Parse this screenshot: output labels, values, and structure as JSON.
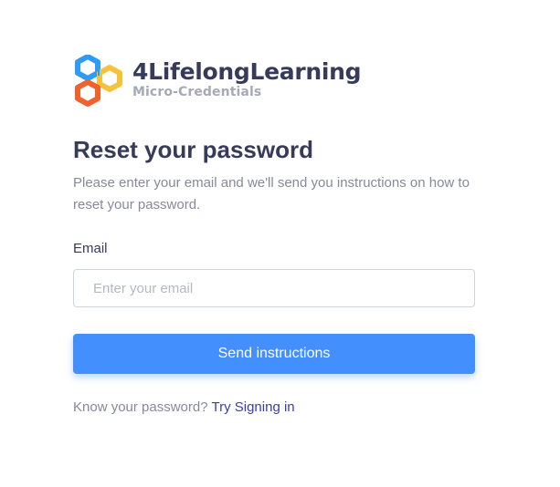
{
  "brand": {
    "name": "4LifelongLearning",
    "tagline": "Micro-Credentials",
    "logo_colors": {
      "blue": "#2e9bf5",
      "yellow": "#f7c23b",
      "orange": "#f0612d"
    },
    "icon": "hexagon-links-logo"
  },
  "form": {
    "title": "Reset your password",
    "description": "Please enter your email and we'll send you instructions on how to reset your password.",
    "email_label": "Email",
    "email_placeholder": "Enter your email",
    "email_value": "",
    "submit_label": "Send instructions"
  },
  "footer": {
    "prompt": "Know your password?",
    "link_label": "Try Signing in"
  },
  "colors": {
    "accent": "#428ffd",
    "heading": "#363b59",
    "muted": "#868a99",
    "link": "#3b3f9c"
  }
}
